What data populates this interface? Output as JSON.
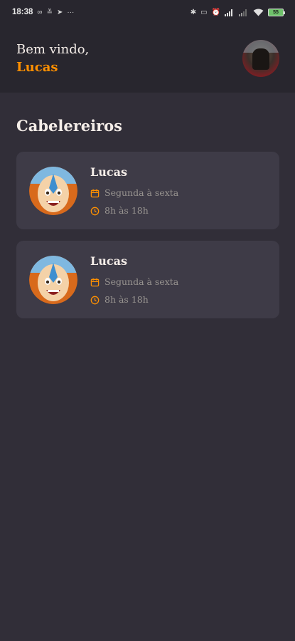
{
  "status_bar": {
    "time": "18:38",
    "left_icons": [
      "link-icon",
      "signal-alt-icon",
      "navigation-icon"
    ],
    "more": "···",
    "battery_level": "55"
  },
  "header": {
    "greeting": "Bem vindo,",
    "user_name": "Lucas"
  },
  "section_title": "Cabelereiros",
  "providers": [
    {
      "name": "Lucas",
      "days": "Segunda à sexta",
      "hours": "8h às 18h"
    },
    {
      "name": "Lucas",
      "days": "Segunda à sexta",
      "hours": "8h às 18h"
    }
  ],
  "colors": {
    "accent": "#ff9000",
    "background": "#312e38",
    "header_bg": "#28262e",
    "card_bg": "#3e3b47",
    "text_primary": "#f4ede8",
    "text_muted": "#999591"
  }
}
